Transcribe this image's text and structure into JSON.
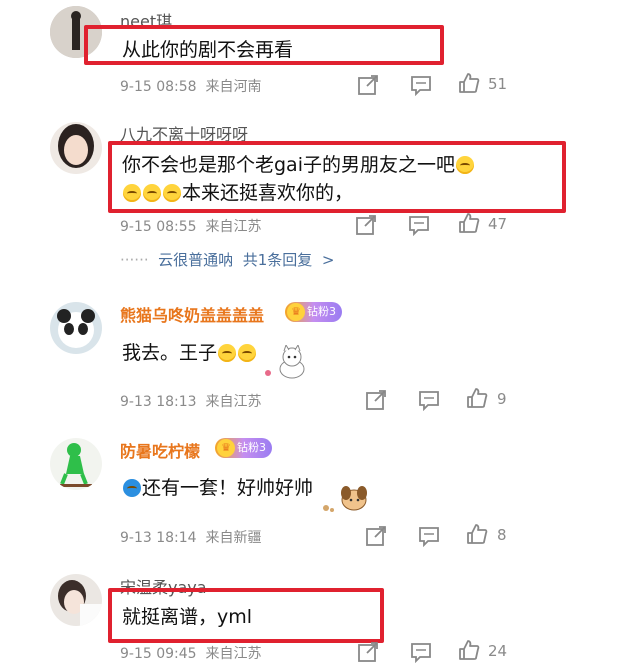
{
  "comments": [
    {
      "username": "neet琪",
      "text": "从此你的剧不会再看",
      "time": "9-15 08:58",
      "location": "来自河南",
      "likes": "51"
    },
    {
      "username": "八九不离十呀呀呀",
      "text_line1": "你不会也是那个老gai子的男朋友之一吧",
      "text_line2": "本来还挺喜欢你的，",
      "time": "9-15 08:55",
      "location": "来自江苏",
      "likes": "47",
      "reply_prefix": "······",
      "reply_user": "云很普通呐",
      "reply_count": "共1条回复",
      "reply_chevron": ">"
    },
    {
      "username": "熊猫乌咚奶盖盖盖盖",
      "badge": "钻粉3",
      "text": "我去。王子",
      "time": "9-13 18:13",
      "location": "来自江苏",
      "likes": "9"
    },
    {
      "username": "防暑吃柠檬",
      "badge": "钻粉3",
      "text": "还有一套！好帅好帅",
      "time": "9-13 18:14",
      "location": "来自新疆",
      "likes": "8"
    },
    {
      "username": "宋温柔yaya",
      "text": "就挺离谱，yml",
      "time": "9-15 09:45",
      "location": "来自江苏",
      "likes": "24"
    }
  ],
  "colors": {
    "highlight": "#e0212f",
    "vip_name": "#e8761c",
    "meta": "#8a8a8a",
    "reply": "#4a6f9c"
  }
}
